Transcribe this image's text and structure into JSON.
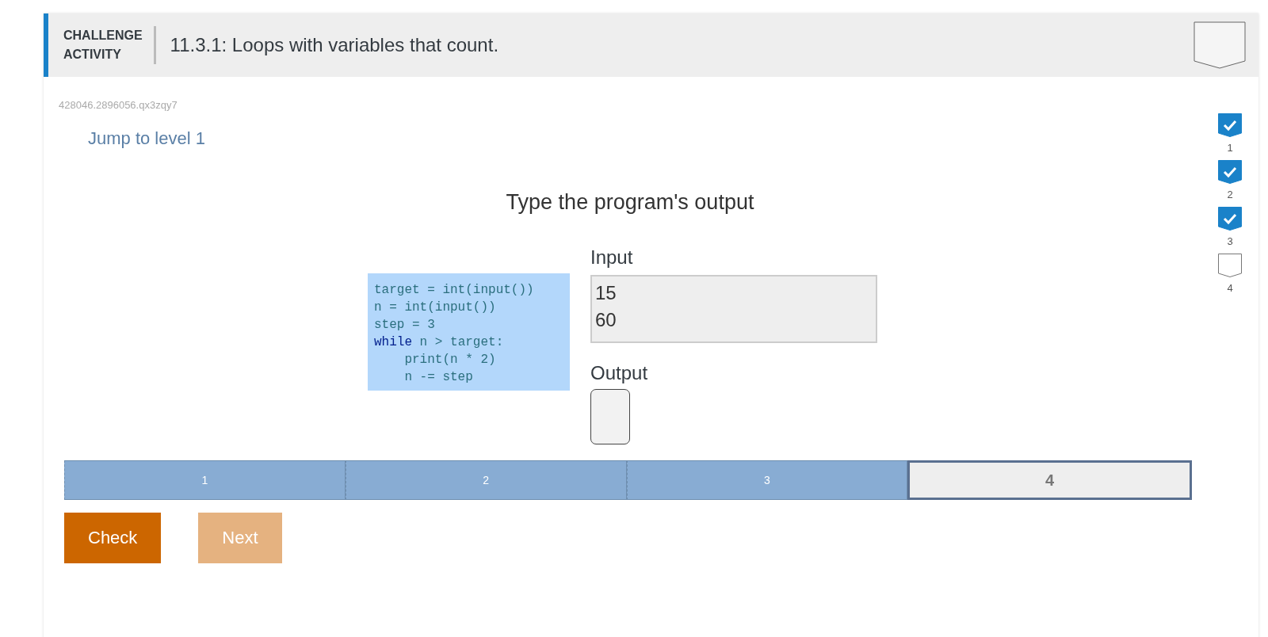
{
  "header": {
    "badge_line_1": "CHALLENGE",
    "badge_line_2": "ACTIVITY",
    "title": "11.3.1: Loops with variables that count.",
    "completed": false
  },
  "activity_id": "428046.2896056.qx3zqy7",
  "jump_link": "Jump to level 1",
  "prompt": "Type the program's output",
  "code_lines": [
    [
      {
        "text": "target = int(input())",
        "kind": "plain"
      }
    ],
    [
      {
        "text": "n = int(input())",
        "kind": "plain"
      }
    ],
    [
      {
        "text": "step = 3",
        "kind": "plain"
      }
    ],
    [
      {
        "text": "while",
        "kind": "keyword"
      },
      {
        "text": " n > target:",
        "kind": "plain"
      }
    ],
    [
      {
        "text": "    print(n * 2)",
        "kind": "plain"
      }
    ],
    [
      {
        "text": "    n -= step",
        "kind": "plain"
      }
    ]
  ],
  "input": {
    "label": "Input",
    "lines": [
      "15",
      "60"
    ]
  },
  "output": {
    "label": "Output"
  },
  "progress": [
    {
      "label": "1",
      "completed": true,
      "selected": false
    },
    {
      "label": "2",
      "completed": true,
      "selected": false
    },
    {
      "label": "3",
      "completed": true,
      "selected": false
    },
    {
      "label": "4",
      "completed": false,
      "selected": true
    }
  ],
  "buttons": [
    {
      "label": "Check",
      "disabled": false
    },
    {
      "label": "Next",
      "disabled": true
    }
  ],
  "levels": [
    {
      "label": "1",
      "checked": true
    },
    {
      "label": "2",
      "checked": true
    },
    {
      "label": "3",
      "checked": true
    },
    {
      "label": "4",
      "checked": false
    }
  ]
}
